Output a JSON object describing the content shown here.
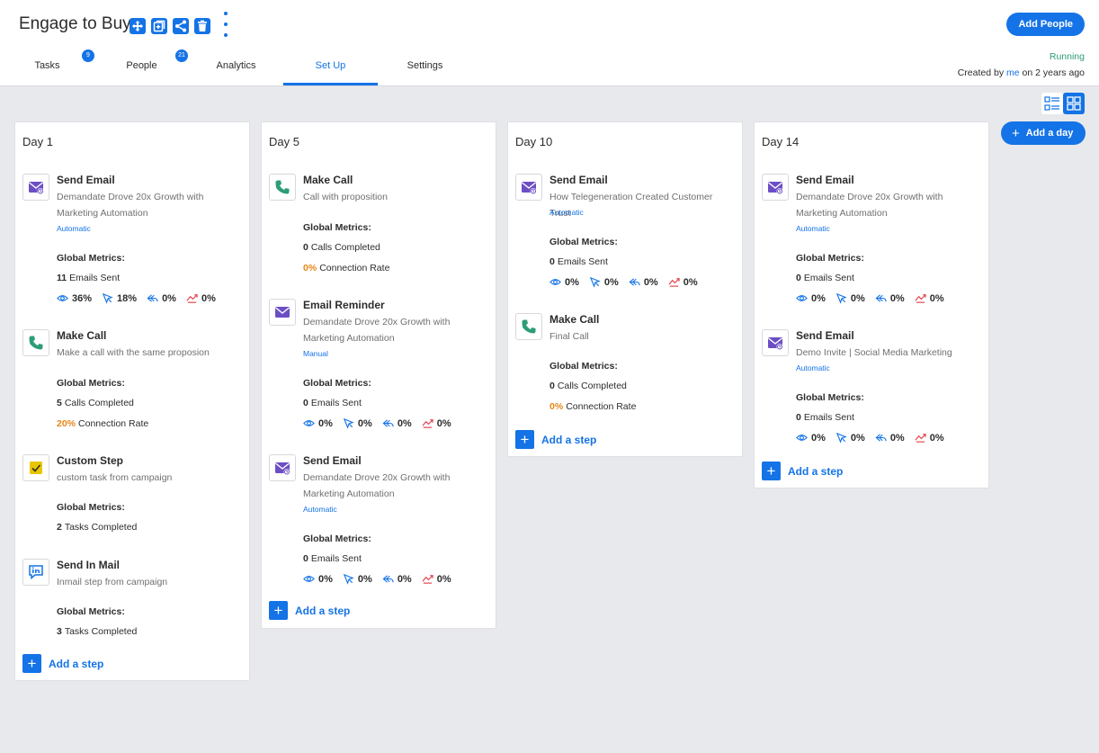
{
  "app": {
    "title": "Engage to Buy",
    "add_people_label": "Add People",
    "status": "Running",
    "created_prefix": "Created by",
    "created_by": "me",
    "created_suffix": "on 2 years ago"
  },
  "tabs": [
    {
      "label": "Tasks",
      "badge": "9"
    },
    {
      "label": "People",
      "badge": "21"
    },
    {
      "label": "Analytics"
    },
    {
      "label": "Set Up"
    },
    {
      "label": "Settings"
    }
  ],
  "add_day_label": "Add a day",
  "add_step_label": "Add a step",
  "plus_glyph": "+",
  "global_metrics_label": "Global Metrics:",
  "colors": {
    "accent": "#1473e6",
    "running": "#2d9d78",
    "rate": "#e68619"
  },
  "days": [
    {
      "title": "Day 1",
      "steps": [
        {
          "icon": "email-icon",
          "title": "Send Email",
          "desc": "Demandate Drove 20x Growth with Marketing Automation",
          "mode": "Automatic",
          "metric": {
            "value": "11",
            "label": "Emails Sent"
          },
          "rates": {
            "open": "36%",
            "click": "18%",
            "reply": "0%",
            "bounce": "0%"
          }
        },
        {
          "icon": "phone-icon",
          "title": "Make Call",
          "desc": "Make a call with the same proposion",
          "metric": {
            "value": "5",
            "label": "Calls Completed"
          },
          "conn": {
            "value": "20%",
            "label": "Connection Rate"
          }
        },
        {
          "icon": "checkbox-icon",
          "title": "Custom Step",
          "desc": "custom task from campaign",
          "metric": {
            "value": "2",
            "label": "Tasks Completed"
          }
        },
        {
          "icon": "inmail-icon",
          "title": "Send In Mail",
          "desc": "Inmail step from campaign",
          "metric": {
            "value": "3",
            "label": "Tasks Completed"
          }
        }
      ]
    },
    {
      "title": "Day 5",
      "steps": [
        {
          "icon": "phone-icon",
          "title": "Make Call",
          "desc": "Call with proposition",
          "metric": {
            "value": "0",
            "label": "Calls Completed"
          },
          "conn": {
            "value": "0%",
            "label": "Connection Rate"
          }
        },
        {
          "icon": "reminder-envelope-icon",
          "title": "Email Reminder",
          "desc": "Demandate Drove 20x Growth with Marketing Automation",
          "mode": "Manual",
          "metric": {
            "value": "0",
            "label": "Emails Sent"
          },
          "rates": {
            "open": "0%",
            "click": "0%",
            "reply": "0%",
            "bounce": "0%"
          }
        },
        {
          "icon": "email-icon",
          "title": "Send Email",
          "desc": "Demandate Drove 20x Growth with Marketing Automation",
          "mode": "Automatic",
          "metric": {
            "value": "0",
            "label": "Emails Sent"
          },
          "rates": {
            "open": "0%",
            "click": "0%",
            "reply": "0%",
            "bounce": "0%"
          }
        }
      ]
    },
    {
      "title": "Day 10",
      "steps": [
        {
          "icon": "email-icon",
          "title": "Send Email",
          "desc": "How Telegeneration Created Customer Trust",
          "mode": "Automatic",
          "metric": {
            "value": "0",
            "label": "Emails Sent"
          },
          "rates": {
            "open": "0%",
            "click": "0%",
            "reply": "0%",
            "bounce": "0%"
          }
        },
        {
          "icon": "phone-icon",
          "title": "Make Call",
          "desc": "Final Call",
          "metric": {
            "value": "0",
            "label": "Calls Completed"
          },
          "conn": {
            "value": "0%",
            "label": "Connection Rate"
          }
        }
      ]
    },
    {
      "title": "Day 14",
      "steps": [
        {
          "icon": "email-icon",
          "title": "Send Email",
          "desc": "Demandate Drove 20x Growth with Marketing Automation",
          "mode": "Automatic",
          "metric": {
            "value": "0",
            "label": "Emails Sent"
          },
          "rates": {
            "open": "0%",
            "click": "0%",
            "reply": "0%",
            "bounce": "0%"
          }
        },
        {
          "icon": "email-icon",
          "title": "Send Email",
          "desc": "Demo Invite | Social Media Marketing",
          "mode": "Automatic",
          "metric": {
            "value": "0",
            "label": "Emails Sent"
          },
          "rates": {
            "open": "0%",
            "click": "0%",
            "reply": "0%",
            "bounce": "0%"
          }
        }
      ]
    }
  ]
}
